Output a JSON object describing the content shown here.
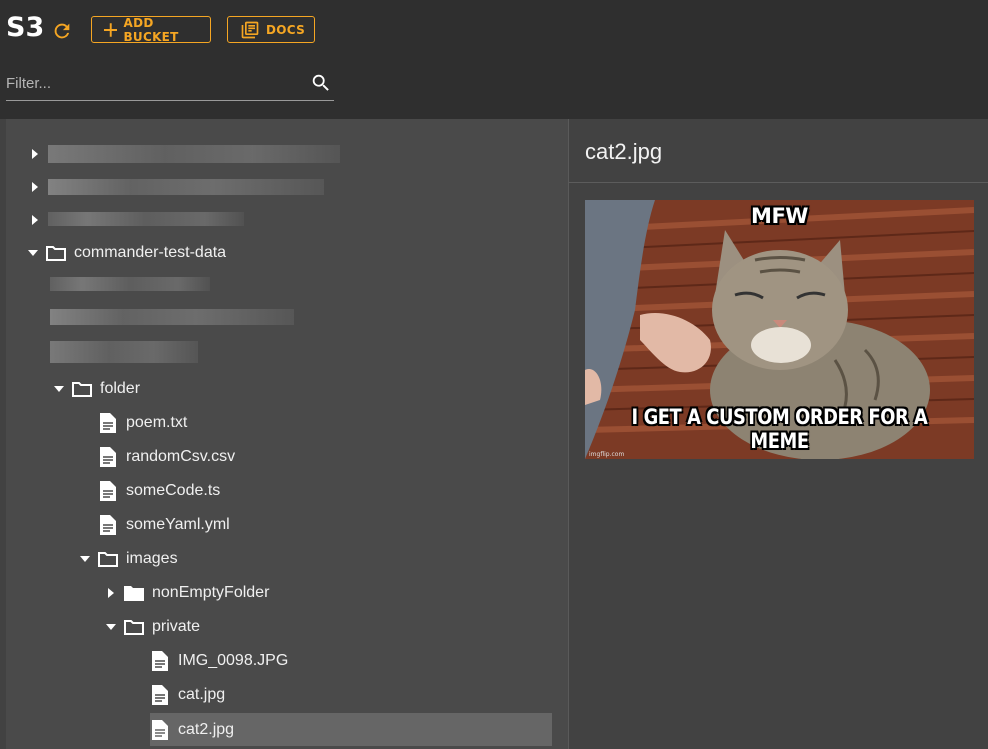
{
  "header": {
    "title": "S3",
    "add_bucket_label": "ADD BUCKET",
    "docs_label": "DOCS",
    "filter_placeholder": "Filter..."
  },
  "colors": {
    "accent": "#f5a623",
    "header_bg": "#2f2f2f",
    "panel_bg": "#4a4a4a",
    "selected_bg": "#666666"
  },
  "tree": {
    "bucket": "commander-test-data",
    "folder": "folder",
    "files": [
      "poem.txt",
      "randomCsv.csv",
      "someCode.ts",
      "someYaml.yml"
    ],
    "images": "images",
    "non_empty_folder": "nonEmptyFolder",
    "private": "private",
    "private_files": [
      "IMG_0098.JPG",
      "cat.jpg",
      "cat2.jpg"
    ]
  },
  "preview": {
    "file_name": "cat2.jpg",
    "meme_top": "MFW",
    "meme_bottom": "I GET A CUSTOM ORDER FOR A MEME"
  },
  "icons": [
    "refresh-icon",
    "plus-icon",
    "docs-icon",
    "search-icon",
    "folder-icon",
    "file-icon",
    "caret-right-icon",
    "caret-down-icon"
  ]
}
